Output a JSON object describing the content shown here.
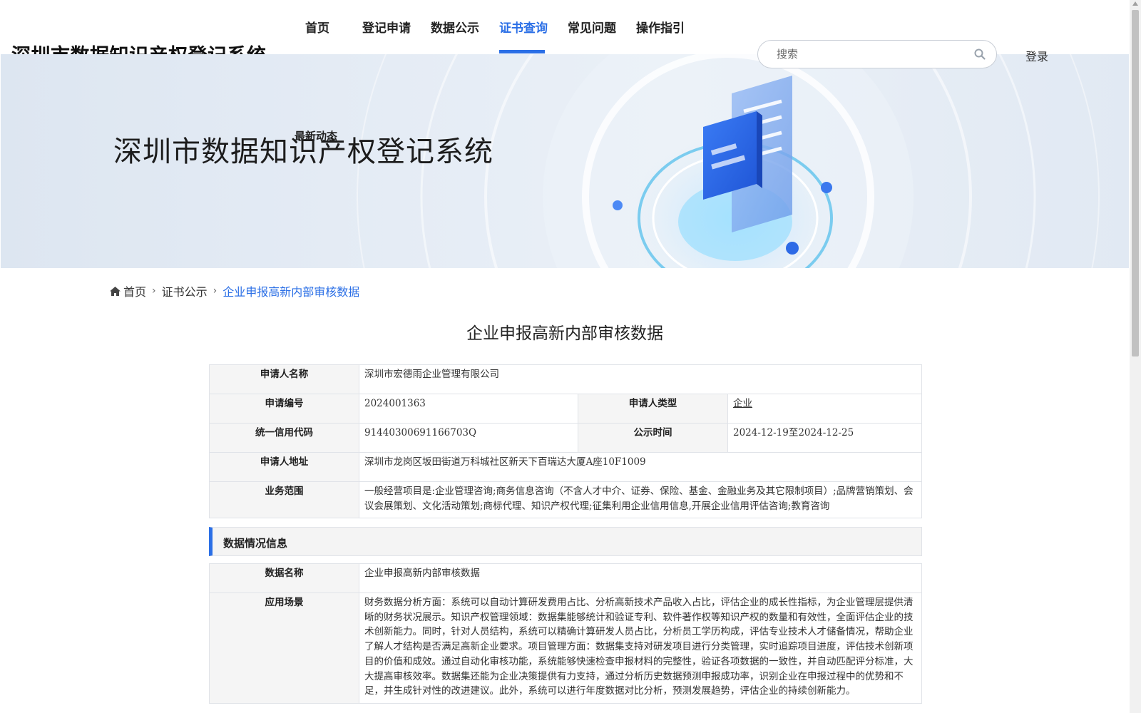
{
  "header": {
    "site_title": "深圳市数据知识产权登记系统",
    "nav": [
      {
        "label": "首页"
      },
      {
        "label": "登记申请"
      },
      {
        "label": "数据公示"
      },
      {
        "label": "证书查询",
        "active": true
      },
      {
        "label": "常见问题"
      },
      {
        "label": "操作指引"
      },
      {
        "label": "最新动态"
      }
    ],
    "search_placeholder": "搜索",
    "login_label": "登录"
  },
  "banner": {
    "title": "深圳市数据知识产权登记系统"
  },
  "breadcrumb": {
    "home": "首页",
    "parent": "证书公示",
    "current": "企业申报高新内部审核数据"
  },
  "page_title": "企业申报高新内部审核数据",
  "applicant_info": {
    "name_label": "申请人名称",
    "name_value": "深圳市宏德雨企业管理有限公司",
    "number_label": "申请编号",
    "number_value": "2024001363",
    "type_label": "申请人类型",
    "type_value": "企业",
    "credit_label": "统一信用代码",
    "credit_value": "91440300691166703Q",
    "publicity_label": "公示时间",
    "publicity_value": "2024-12-19至2024-12-25",
    "address_label": "申请人地址",
    "address_value": "深圳市龙岗区坂田街道万科城社区新天下百瑞达大厦A座10F1009",
    "scope_label": "业务范围",
    "scope_value": "一般经营项目是:企业管理咨询;商务信息咨询（不含人才中介、证券、保险、基金、金融业务及其它限制项目）;品牌营销策划、会议会展策划、文化活动策划;商标代理、知识产权代理;征集利用企业信用信息,开展企业信用评估咨询;教育咨询"
  },
  "data_section": {
    "title": "数据情况信息",
    "data_name_label": "数据名称",
    "data_name_value": "企业申报高新内部审核数据",
    "scenario_label": "应用场景",
    "scenario_value": "财务数据分析方面：系统可以自动计算研发费用占比、分析高新技术产品收入占比，评估企业的成长性指标，为企业管理层提供清晰的财务状况展示。知识产权管理领域：数据集能够统计和验证专利、软件著作权等知识产权的数量和有效性，全面评估企业的技术创新能力。同时，针对人员结构，系统可以精确计算研发人员占比，分析员工学历构成，评估专业技术人才储备情况，帮助企业了解人才结构是否满足高新企业要求。项目管理方面：数据集支持对研发项目进行分类管理，实时追踪项目进度，评估技术创新项目的价值和成效。通过自动化审核功能，系统能够快速检查申报材料的完整性，验证各项数据的一致性，并自动匹配评分标准，大大提高审核效率。数据集还能为企业决策提供有力支持，通过分析历史数据预测申报成功率，识别企业在申报过程中的优势和不足，并生成针对性的改进建议。此外，系统可以进行年度数据对比分析，预测发展趋势，评估企业的持续创新能力。"
  },
  "colors": {
    "accent": "#2b6fe6",
    "label_bg": "#f5f5f5",
    "border": "#e0e3e8"
  }
}
